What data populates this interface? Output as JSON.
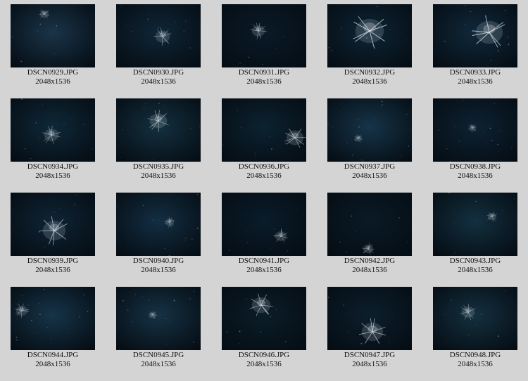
{
  "thumbnails": [
    {
      "filename": "DSCN0929.JPG",
      "dimensions": "2048x1536",
      "subject": "jellyfish",
      "bg": "#1a3448"
    },
    {
      "filename": "DSCN0930.JPG",
      "dimensions": "2048x1536",
      "subject": "jellyfish",
      "bg": "#0f2636"
    },
    {
      "filename": "DSCN0931.JPG",
      "dimensions": "2048x1536",
      "subject": "jellyfish",
      "bg": "#0a1a28"
    },
    {
      "filename": "DSCN0932.JPG",
      "dimensions": "2048x1536",
      "subject": "jellyfish",
      "bg": "#0d2434"
    },
    {
      "filename": "DSCN0933.JPG",
      "dimensions": "2048x1536",
      "subject": "jellyfish",
      "bg": "#10283a"
    },
    {
      "filename": "DSCN0934.JPG",
      "dimensions": "2048x1536",
      "subject": "jellyfish",
      "bg": "#0f2838"
    },
    {
      "filename": "DSCN0935.JPG",
      "dimensions": "2048x1536",
      "subject": "jellyfish",
      "bg": "#14303f"
    },
    {
      "filename": "DSCN0936.JPG",
      "dimensions": "2048x1536",
      "subject": "jellyfish",
      "bg": "#0c2230"
    },
    {
      "filename": "DSCN0937.JPG",
      "dimensions": "2048x1536",
      "subject": "jellyfish",
      "bg": "#163448"
    },
    {
      "filename": "DSCN0938.JPG",
      "dimensions": "2048x1536",
      "subject": "jellyfish",
      "bg": "#0d2232"
    },
    {
      "filename": "DSCN0939.JPG",
      "dimensions": "2048x1536",
      "subject": "jellyfish",
      "bg": "#0e2434"
    },
    {
      "filename": "DSCN0940.JPG",
      "dimensions": "2048x1536",
      "subject": "jellyfish",
      "bg": "#132e42"
    },
    {
      "filename": "DSCN0941.JPG",
      "dimensions": "2048x1536",
      "subject": "jellyfish",
      "bg": "#0a1c2a"
    },
    {
      "filename": "DSCN0942.JPG",
      "dimensions": "2048x1536",
      "subject": "jellyfish",
      "bg": "#0a1a26"
    },
    {
      "filename": "DSCN0943.JPG",
      "dimensions": "2048x1536",
      "subject": "jellyfish",
      "bg": "#13303f"
    },
    {
      "filename": "DSCN0944.JPG",
      "dimensions": "2048x1536",
      "subject": "jellyfish",
      "bg": "#163448"
    },
    {
      "filename": "DSCN0945.JPG",
      "dimensions": "2048x1536",
      "subject": "jellyfish",
      "bg": "#163244"
    },
    {
      "filename": "DSCN0946.JPG",
      "dimensions": "2048x1536",
      "subject": "jellyfish",
      "bg": "#0b1d28"
    },
    {
      "filename": "DSCN0947.JPG",
      "dimensions": "2048x1536",
      "subject": "jellyfish",
      "bg": "#0c1e2c"
    },
    {
      "filename": "DSCN0948.JPG",
      "dimensions": "2048x1536",
      "subject": "jellyfish",
      "bg": "#14303f"
    }
  ]
}
